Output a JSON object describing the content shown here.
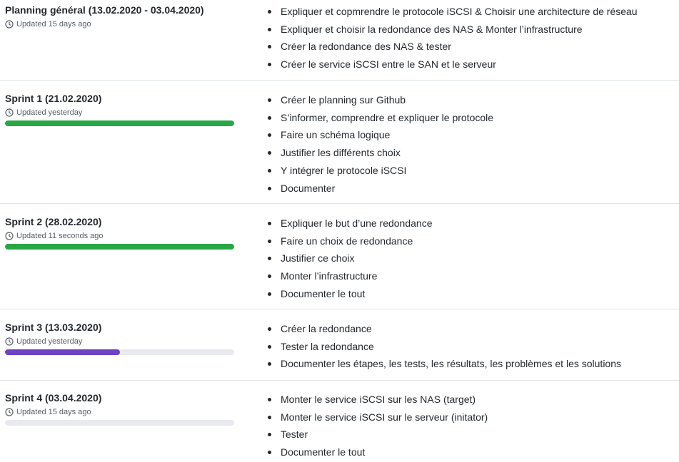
{
  "milestones": [
    {
      "title": "Planning général (13.02.2020 - 03.04.2020)",
      "updated": "Updated 15 days ago",
      "progress": null,
      "tasks": [
        "Expliquer et copmrendre le protocole iSCSI & Choisir une architecture de réseau",
        "Expliquer et choisir la redondance des NAS & Monter l’infrastructure",
        "Créer la redondance des NAS & tester",
        "Créer le service iSCSI entre le SAN et le serveur"
      ]
    },
    {
      "title": "Sprint 1 (21.02.2020)",
      "updated": "Updated yesterday",
      "progress": 100,
      "progress_color": "#28a745",
      "tasks": [
        "Créer le planning sur Github",
        "S’informer, comprendre et expliquer le protocole",
        "Faire un schéma logique",
        "Justifier les différents choix",
        "Y intégrer le protocole iSCSI",
        "Documenter"
      ]
    },
    {
      "title": "Sprint 2 (28.02.2020)",
      "updated": "Updated 11 seconds ago",
      "progress": 100,
      "progress_color": "#28a745",
      "tasks": [
        "Expliquer le but d’une redondance",
        "Faire un choix de redondance",
        "Justifier ce choix",
        "Monter l’infrastructure",
        "Documenter le tout"
      ]
    },
    {
      "title": "Sprint 3 (13.03.2020)",
      "updated": "Updated yesterday",
      "progress": 50,
      "progress_color": "#6f42c1",
      "tasks": [
        "Créer la redondance",
        "Tester la redondance",
        "Documenter les étapes, les tests, les résultats, les problèmes et les solutions"
      ]
    },
    {
      "title": "Sprint 4 (03.04.2020)",
      "updated": "Updated 15 days ago",
      "progress": 0,
      "progress_color": "#6f42c1",
      "tasks": [
        "Monter le service iSCSI sur les NAS (target)",
        "Monter le service iSCSI sur le serveur (initator)",
        "Tester",
        "Documenter le tout"
      ]
    }
  ],
  "icons": {
    "updated_icon": "clock-icon"
  },
  "colors": {
    "track": "#e9eaee",
    "divider": "#e1e4e8"
  }
}
